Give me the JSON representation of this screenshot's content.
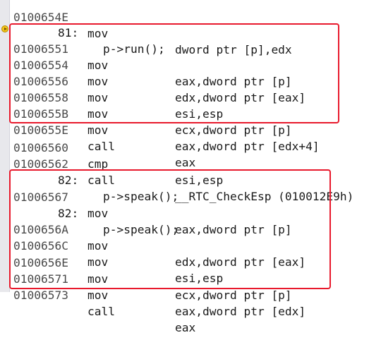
{
  "source_lines": {
    "top_partial": {
      "address": "0100654E",
      "mnemonic": "mov",
      "operands": "dword ptr [p],edx"
    },
    "run": {
      "line_number": "81:",
      "text": "p->run();"
    },
    "speak_a": {
      "line_number": "82:",
      "text": "p->speak();"
    },
    "speak_b": {
      "line_number": "82:",
      "text": "p->speak();"
    }
  },
  "block1": [
    {
      "address": "01006551",
      "mnemonic": "mov",
      "operands": "eax,dword ptr [p]"
    },
    {
      "address": "01006554",
      "mnemonic": "mov",
      "operands": "edx,dword ptr [eax]"
    },
    {
      "address": "01006556",
      "mnemonic": "mov",
      "operands": "esi,esp"
    },
    {
      "address": "01006558",
      "mnemonic": "mov",
      "operands": "ecx,dword ptr [p]"
    },
    {
      "address": "0100655B",
      "mnemonic": "mov",
      "operands": "eax,dword ptr [edx+4]"
    },
    {
      "address": "0100655E",
      "mnemonic": "call",
      "operands": "eax"
    }
  ],
  "between": [
    {
      "address": "01006560",
      "mnemonic": "cmp",
      "operands": "esi,esp"
    },
    {
      "address": "01006562",
      "mnemonic": "call",
      "operands": "__RTC_CheckEsp (010012E9h)"
    }
  ],
  "block2_first": {
    "address": "01006567",
    "mnemonic": "mov",
    "operands": "eax,dword ptr [p]"
  },
  "block2_rest": [
    {
      "address": "0100656A",
      "mnemonic": "mov",
      "operands": "edx,dword ptr [eax]"
    },
    {
      "address": "0100656C",
      "mnemonic": "mov",
      "operands": "esi,esp"
    },
    {
      "address": "0100656E",
      "mnemonic": "mov",
      "operands": "ecx,dword ptr [p]"
    },
    {
      "address": "01006571",
      "mnemonic": "mov",
      "operands": "eax,dword ptr [edx]"
    },
    {
      "address": "01006573",
      "mnemonic": "call",
      "operands": "eax"
    }
  ],
  "icons": {
    "current_instruction": "instruction-pointer-arrow-icon"
  },
  "colors": {
    "highlight_border": "#e8192c",
    "address_text": "#4a4a4a"
  }
}
